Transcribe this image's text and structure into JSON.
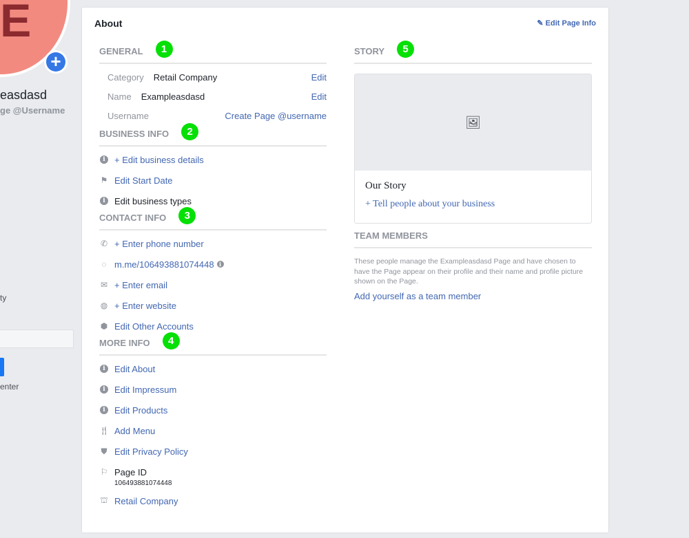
{
  "sidebar": {
    "avatar_letter": "E",
    "page_name": "easdasd",
    "username": "ge @Username",
    "text_fragment_1": "ty",
    "text_fragment_2": "enter"
  },
  "card": {
    "title": "About",
    "edit_page_info": "Edit Page Info",
    "general": {
      "heading": "GENERAL",
      "badge": "1",
      "category_label": "Category",
      "category_value": "Retail Company",
      "name_label": "Name",
      "name_value": "Exampleasdasd",
      "username_label": "Username",
      "create_username": "Create Page @username",
      "edit": "Edit"
    },
    "business": {
      "heading": "BUSINESS INFO",
      "badge": "2",
      "items": [
        "+ Edit business details",
        "Edit Start Date",
        "Edit business types"
      ]
    },
    "contact": {
      "heading": "CONTACT INFO",
      "badge": "3",
      "items": [
        "+ Enter phone number",
        "m.me/106493881074448",
        "+ Enter email",
        "+ Enter website",
        "Edit Other Accounts"
      ]
    },
    "more": {
      "heading": "MORE INFO",
      "badge": "4",
      "items": [
        "Edit About",
        "Edit Impressum",
        "Edit Products",
        "Add Menu",
        "Edit Privacy Policy"
      ],
      "page_id_label": "Page ID",
      "page_id_value": "106493881074448",
      "category_link": "Retail Company"
    },
    "story": {
      "heading": "STORY",
      "badge": "5",
      "title": "Our Story",
      "cta": "+ Tell people about your business"
    },
    "team": {
      "heading": "TEAM MEMBERS",
      "description": "These people manage the Exampleasdasd Page and have chosen to have the Page appear on their profile and their name and profile picture shown on the Page.",
      "add_link": "Add yourself as a team member"
    }
  },
  "colors": {
    "link": "#4267b2",
    "badge": "#06e006",
    "avatar": "#f28a80"
  }
}
